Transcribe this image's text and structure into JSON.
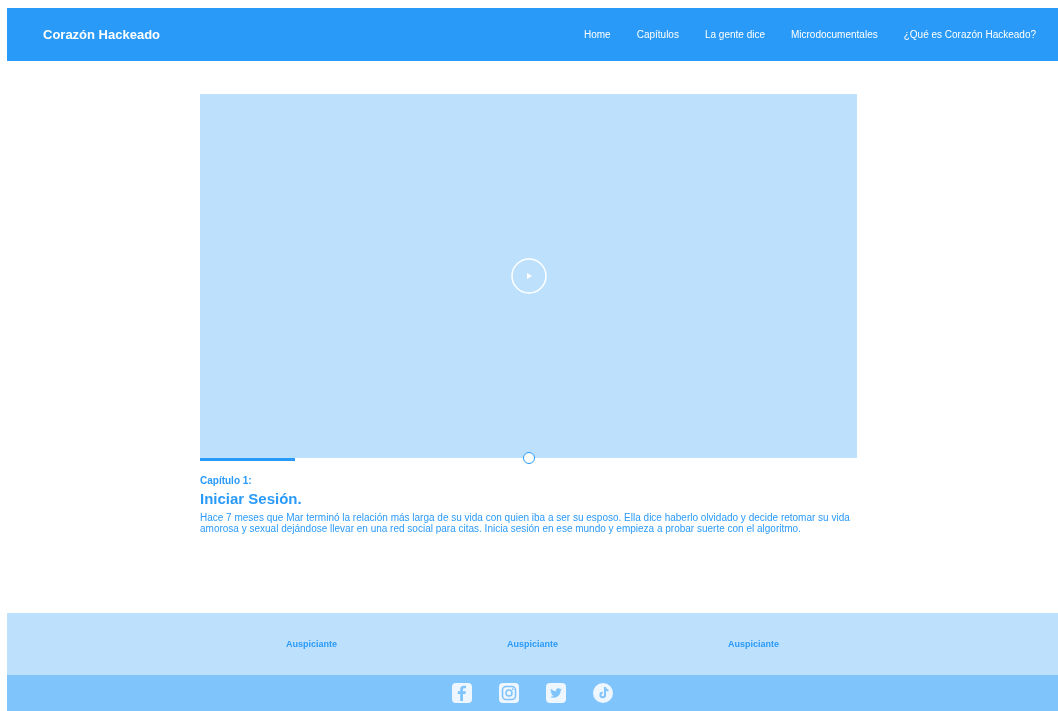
{
  "header": {
    "brand": "Corazón Hackeado",
    "nav": [
      {
        "label": "Home"
      },
      {
        "label": "Capítulos"
      },
      {
        "label": "La gente dice"
      },
      {
        "label": "Microdocumentales"
      },
      {
        "label": "¿Qué es Corazón Hackeado?"
      }
    ]
  },
  "video": {
    "playing": false,
    "progress": {
      "level": 0.145
    },
    "scrubber": {
      "level": 0.5
    }
  },
  "chapter": {
    "number": "Capítulo 1:",
    "title": "Iniciar Sesión.",
    "description": "Hace 7 meses que Mar terminó la relación más larga de su vida con quien iba a ser su esposo. Ella dice haberlo olvidado y decide retomar su vida amorosa y sexual dejándose llevar en una red social para citas. Inicia sesión en ese mundo y empieza a probar suerte con el algoritmo."
  },
  "footer": {
    "sponsors": [
      "Auspiciante",
      "Auspiciante",
      "Auspiciante"
    ],
    "social": [
      {
        "kind": "facebook"
      },
      {
        "kind": "instagram"
      },
      {
        "kind": "twitter"
      },
      {
        "kind": "tiktok"
      }
    ]
  }
}
